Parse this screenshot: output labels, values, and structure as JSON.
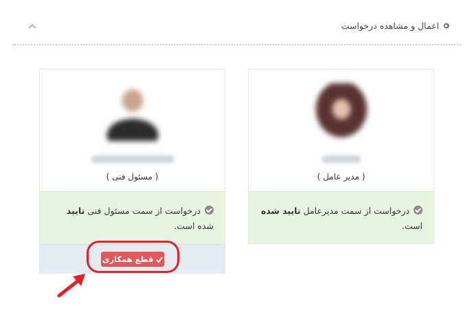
{
  "panel": {
    "title": "اعمال و مشاهده درخواست",
    "icons": {
      "title_icon": "gear-icon",
      "collapse_icon": "chevron-up-icon"
    }
  },
  "cards": {
    "manager": {
      "role": "( مدیر عامل )",
      "status_text": "درخواست از سمت مدیرعامل ",
      "status_bold": "تایید شده",
      "status_tail": " است."
    },
    "tech": {
      "role": "( مسئول فنی )",
      "status_text": "درخواست از سمت مسئول فنی ",
      "status_bold": "تایید",
      "status_tail": " شده است.",
      "action_label": "قطع همکاری"
    }
  },
  "colors": {
    "success_bg": "#e8f3e0",
    "danger": "#e0585b",
    "annotation": "#e2202a"
  }
}
